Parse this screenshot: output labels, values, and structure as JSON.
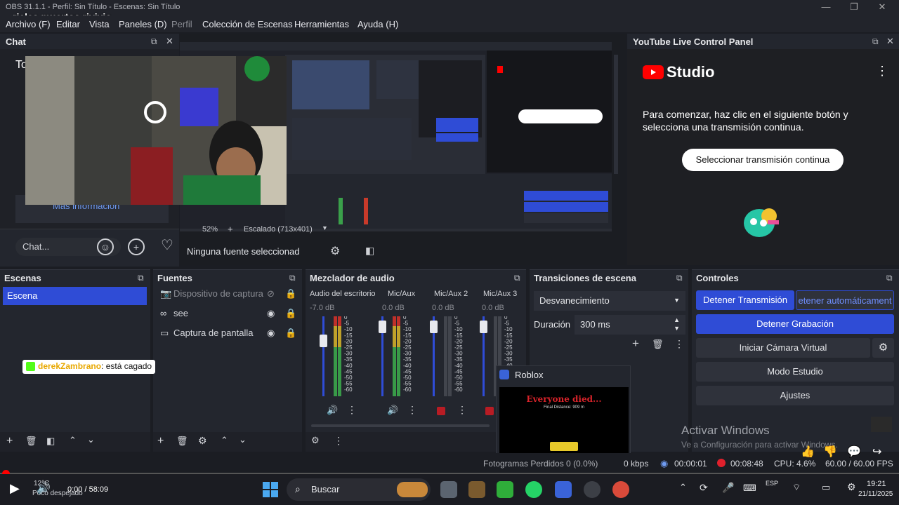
{
  "window": {
    "title": "OBS 31.1.1 - Perfil: Sin Título - Escenas: Sin Título",
    "overlay_text": "rieles muertos rivivio"
  },
  "menu": [
    "Archivo (F)",
    "Editar",
    "Vista",
    "Paneles (D)",
    "Perfil",
    "Colección de Escenas",
    "Herramientas",
    "Ayuda (H)"
  ],
  "chat": {
    "title": "Chat",
    "partial_text": "To",
    "more_info": "Más información",
    "input_placeholder": "Chat..."
  },
  "preview": {
    "zoom": "52%",
    "scale_label": "Escalado (713x401)",
    "no_source": "Ninguna fuente seleccionad"
  },
  "youtube": {
    "title": "YouTube Live Control Panel",
    "brand": "Studio",
    "description": "Para comenzar, haz clic en el siguiente botón y selecciona una transmisión continua.",
    "select_button": "Seleccionar transmisión continua"
  },
  "scenes": {
    "title": "Escenas",
    "items": [
      "Escena"
    ]
  },
  "sources": {
    "title": "Fuentes",
    "items": [
      {
        "label": "Dispositivo de captura",
        "icon": "camera-icon",
        "visible": false
      },
      {
        "label": "see",
        "icon": "link-icon",
        "visible": true
      },
      {
        "label": "Captura de pantalla",
        "icon": "monitor-icon",
        "visible": true
      }
    ]
  },
  "chat_message": {
    "user": "derekZambrano",
    "text": ": está cagado"
  },
  "mixer": {
    "title": "Mezclador de audio",
    "channels": [
      {
        "name": "Audio del escritorio",
        "db": "-7.0 dB"
      },
      {
        "name": "Mic/Aux",
        "db": "0.0 dB"
      },
      {
        "name": "Mic/Aux 2",
        "db": "0.0 dB"
      },
      {
        "name": "Mic/Aux 3",
        "db": "0.0 dB"
      }
    ],
    "scale": [
      "0",
      "-5",
      "-10",
      "-15",
      "-20",
      "-25",
      "-30",
      "-35",
      "-40",
      "-45",
      "-50",
      "-55",
      "-60"
    ]
  },
  "transitions": {
    "title": "Transiciones de escena",
    "type": "Desvanecimiento",
    "duration_label": "Duración",
    "duration_value": "300 ms"
  },
  "roblox": {
    "label": "Roblox",
    "game_title": "Everyone died...",
    "sub": "Final Distance: 909 m"
  },
  "controls": {
    "title": "Controles",
    "stop_stream": "Detener Transmisión",
    "auto_stop": "etener automáticament",
    "stop_record": "Detener Grabación",
    "virtual_cam": "Iniciar Cámara Virtual",
    "studio_mode": "Modo Estudio",
    "settings": "Ajustes"
  },
  "watermark": {
    "line1": "Activar Windows",
    "line2": "Ve a Configuración para activar Windows."
  },
  "status": {
    "dropped": "Fotogramas Perdidos 0 (0.0%)",
    "kbps": "0 kbps",
    "stream_time": "00:00:01",
    "rec_time": "00:08:48",
    "cpu": "CPU: 4.6%",
    "fps": "60.00 / 60.00 FPS"
  },
  "player": {
    "time": "0:00 / 58:09",
    "progress": 0.0
  },
  "taskbar": {
    "weather_temp": "12°C",
    "weather_desc": "Poco despejado",
    "search": "Buscar",
    "lang": "ESP",
    "time": "19:21",
    "date": "21/11/2025"
  },
  "colors": {
    "accent_blue": "#2f4cd6",
    "record_red": "#e0202c",
    "yt_red": "#ff0000"
  }
}
